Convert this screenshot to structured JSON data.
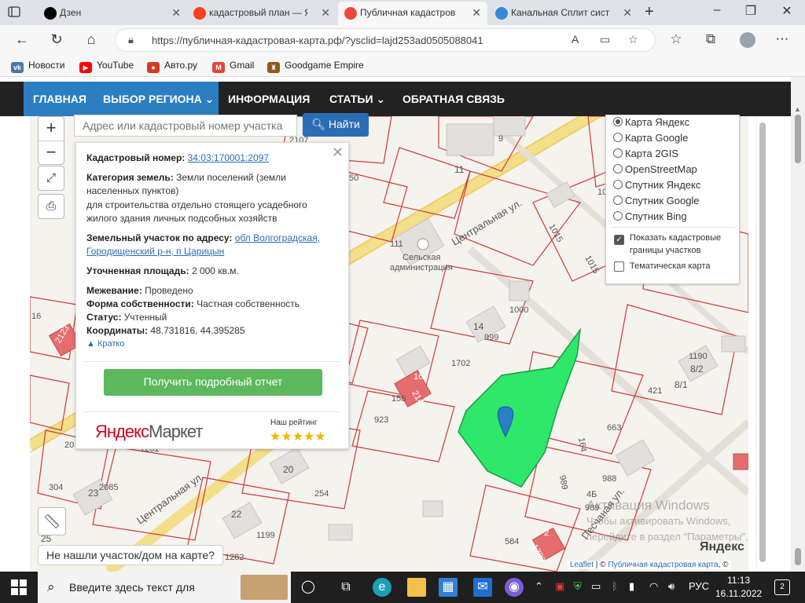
{
  "browser": {
    "tabs": [
      {
        "label": "Дзен",
        "favicon_color": "#000000",
        "active": false
      },
      {
        "label": "кадастровый план — Я",
        "favicon_color": "#fc3f1d",
        "active": false
      },
      {
        "label": "Публичная кадастров",
        "favicon_color": "#e84b3c",
        "active": true
      },
      {
        "label": "Канальная Сплит систе",
        "favicon_color": "#3a88d8",
        "active": false
      }
    ],
    "url": "https://публичная-кадастровая-карта.рф/?ysclid=lajd253ad0505088041",
    "bookmarks": [
      {
        "label": "Новости",
        "icon": "vk-icon",
        "color": "#4a76a8"
      },
      {
        "label": "YouTube",
        "icon": "youtube-icon",
        "color": "#ff0000"
      },
      {
        "label": "Авто.ру",
        "icon": "autoru-icon",
        "color": "#db3727"
      },
      {
        "label": "Gmail",
        "icon": "gmail-icon",
        "color": "#ea4335"
      },
      {
        "label": "Goodgame Empire",
        "icon": "goodgame-icon",
        "color": "#8a5a1a"
      }
    ]
  },
  "site_nav": {
    "items": [
      "ГЛАВНАЯ",
      "ВЫБОР РЕГИОНА ⌄",
      "ИНФОРМАЦИЯ",
      "СТАТЬИ ⌄",
      "ОБРАТНАЯ СВЯЗЬ"
    ]
  },
  "search": {
    "placeholder": "Адрес или кадастровый номер участка",
    "button": "Найти"
  },
  "popup": {
    "cad_label": "Кадастровый номер:",
    "cad_value": "34:03:170001:2097",
    "cat_label": "Категория земель:",
    "cat_value": "Земли поселений (земли населенных пунктов)",
    "use_value": "для строительства отдельно стоящего усадебного жилого здания личных подсобных хозяйств",
    "addr_label": "Земельный участок по адресу:",
    "addr_value": "обл Волгоградская, Городищенский р-н, п Царицын",
    "area_label": "Уточненная площадь:",
    "area_value": "2 000 кв.м.",
    "survey_label": "Межевание:",
    "survey_value": "Проведено",
    "own_label": "Форма собственности:",
    "own_value": "Частная собственность",
    "status_label": "Статус:",
    "status_value": "Учтенный",
    "coord_label": "Координаты:",
    "coord_value": "48.731816, 44.395285",
    "toggle": "Кратко",
    "report_button": "Получить подробный отчет",
    "market_brand_red": "Яндекс",
    "market_brand": "Маркет",
    "rating_label": "Наш рейтинг",
    "rating_stars": 5,
    "stars_text": "★★★★★"
  },
  "layers": {
    "options": [
      {
        "label": "Карта Яндекс",
        "selected": true
      },
      {
        "label": "Карта Google",
        "selected": false
      },
      {
        "label": "Карта 2GIS",
        "selected": false
      },
      {
        "label": "OpenStreetMap",
        "selected": false
      },
      {
        "label": "Спутник Яндекс",
        "selected": false
      },
      {
        "label": "Спутник Google",
        "selected": false
      },
      {
        "label": "Спутник Bing",
        "selected": false
      }
    ],
    "checks": [
      {
        "label": "Показать кадастровые границы участков",
        "checked": true
      },
      {
        "label": "Тематическая карта",
        "checked": false
      }
    ]
  },
  "map": {
    "labels": [
      "9",
      "11",
      "111",
      "Сельская администрация",
      "Центральная ул.",
      "1015",
      "1015",
      "10",
      "1000",
      "14",
      "999",
      "1702",
      "16",
      "156",
      "2145",
      "923",
      "1190",
      "8/2",
      "8/1",
      "421",
      "663",
      "164",
      "988",
      "989",
      "4Б",
      "989",
      "20",
      "254",
      "22",
      "1199",
      "1282",
      "1261",
      "2085",
      "23",
      "304",
      "Центральная ул.",
      "584",
      "2",
      "1780",
      "Песчаная ул.",
      "25",
      "2107",
      "16",
      "2123",
      "20",
      "50"
    ],
    "highlight_color": "#2ee86a",
    "marker_color": "#2b7ec1",
    "not_found": "Не нашли участок/дом на карте?",
    "attrib_leaflet": "Leaflet",
    "attrib_sep": " | © ",
    "attrib_site": "Публичная кадастровая карта",
    "attrib_end": ", ©",
    "yandex_logo": "Яндекс",
    "terms": "© Яндекс Условия использования",
    "activation_title": "Активация Windows",
    "activation_line1": "Чтобы активировать Windows,",
    "activation_line2": "перейдите в раздел \"Параметры\"."
  },
  "taskbar": {
    "search_text": "Введите здесь текст для",
    "tray_lang": "РУС",
    "time": "11:13",
    "date": "16.11.2022",
    "notif_count": "2"
  }
}
